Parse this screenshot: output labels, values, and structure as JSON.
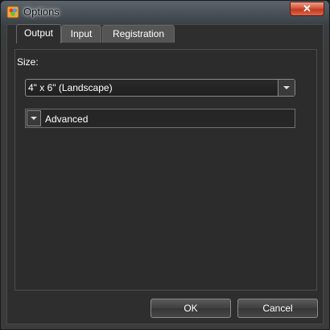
{
  "window": {
    "title": "Options",
    "close_glyph": "✕"
  },
  "tabs": [
    {
      "label": "Output",
      "active": true
    },
    {
      "label": "Input",
      "active": false
    },
    {
      "label": "Registration",
      "active": false
    }
  ],
  "output": {
    "size_label": "Size:",
    "size_value": "4\" x 6\" (Landscape)",
    "advanced_label": "Advanced"
  },
  "buttons": {
    "ok": "OK",
    "cancel": "Cancel"
  },
  "icons": {
    "app": "app-icon",
    "close": "close-icon",
    "dropdown": "chevron-down-icon",
    "expander": "expand-icon"
  }
}
